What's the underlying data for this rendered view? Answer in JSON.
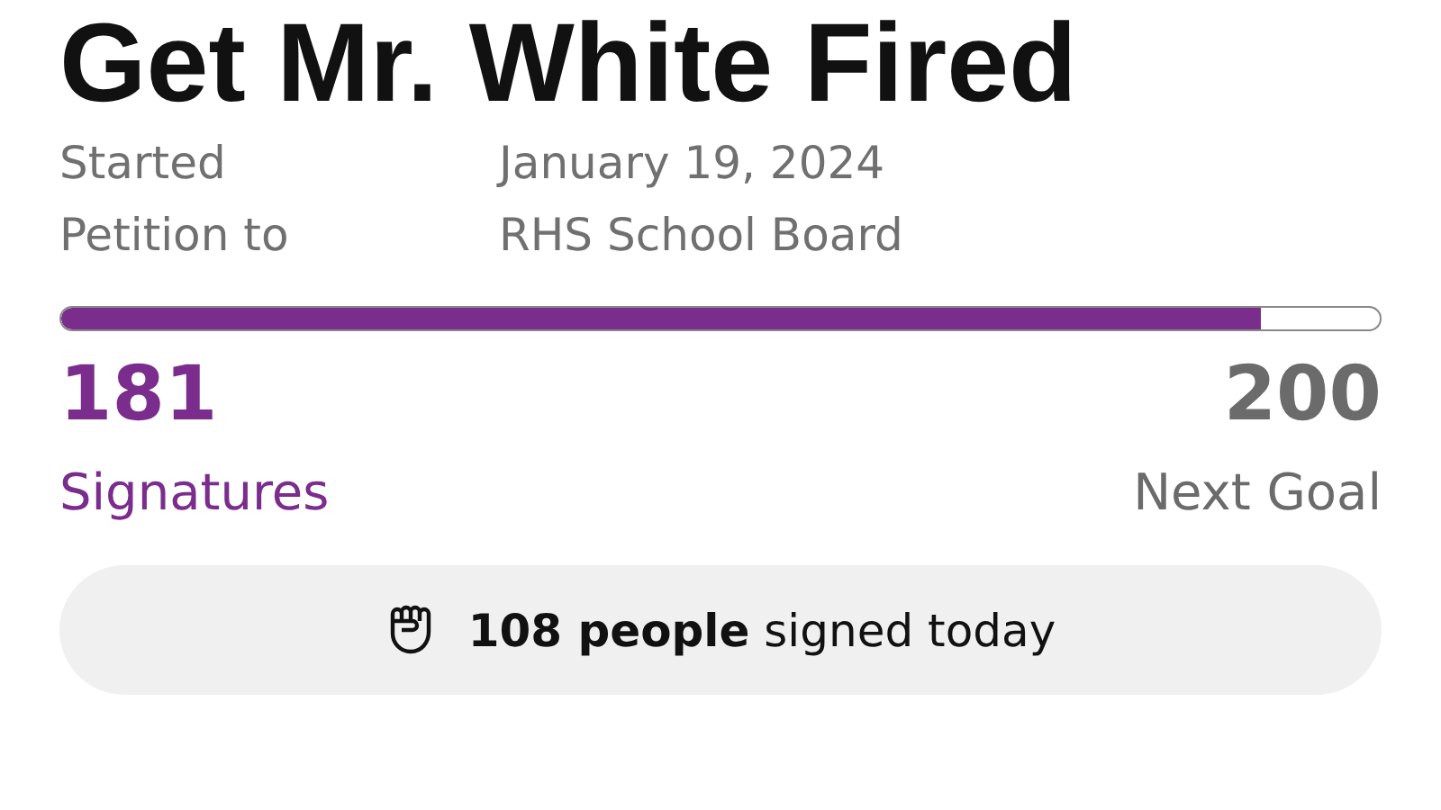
{
  "title": "Get Mr. White Fired",
  "details": [
    {
      "label": "Started",
      "value": "January 19, 2024"
    },
    {
      "label": "Petition to",
      "value": "RHS School Board"
    }
  ],
  "progress": {
    "level": 0.91,
    "count": "181",
    "count_label": "Signatures",
    "goal": "200",
    "goal_label": "Next Goal"
  },
  "today": {
    "text": "**108 people** signed today"
  }
}
